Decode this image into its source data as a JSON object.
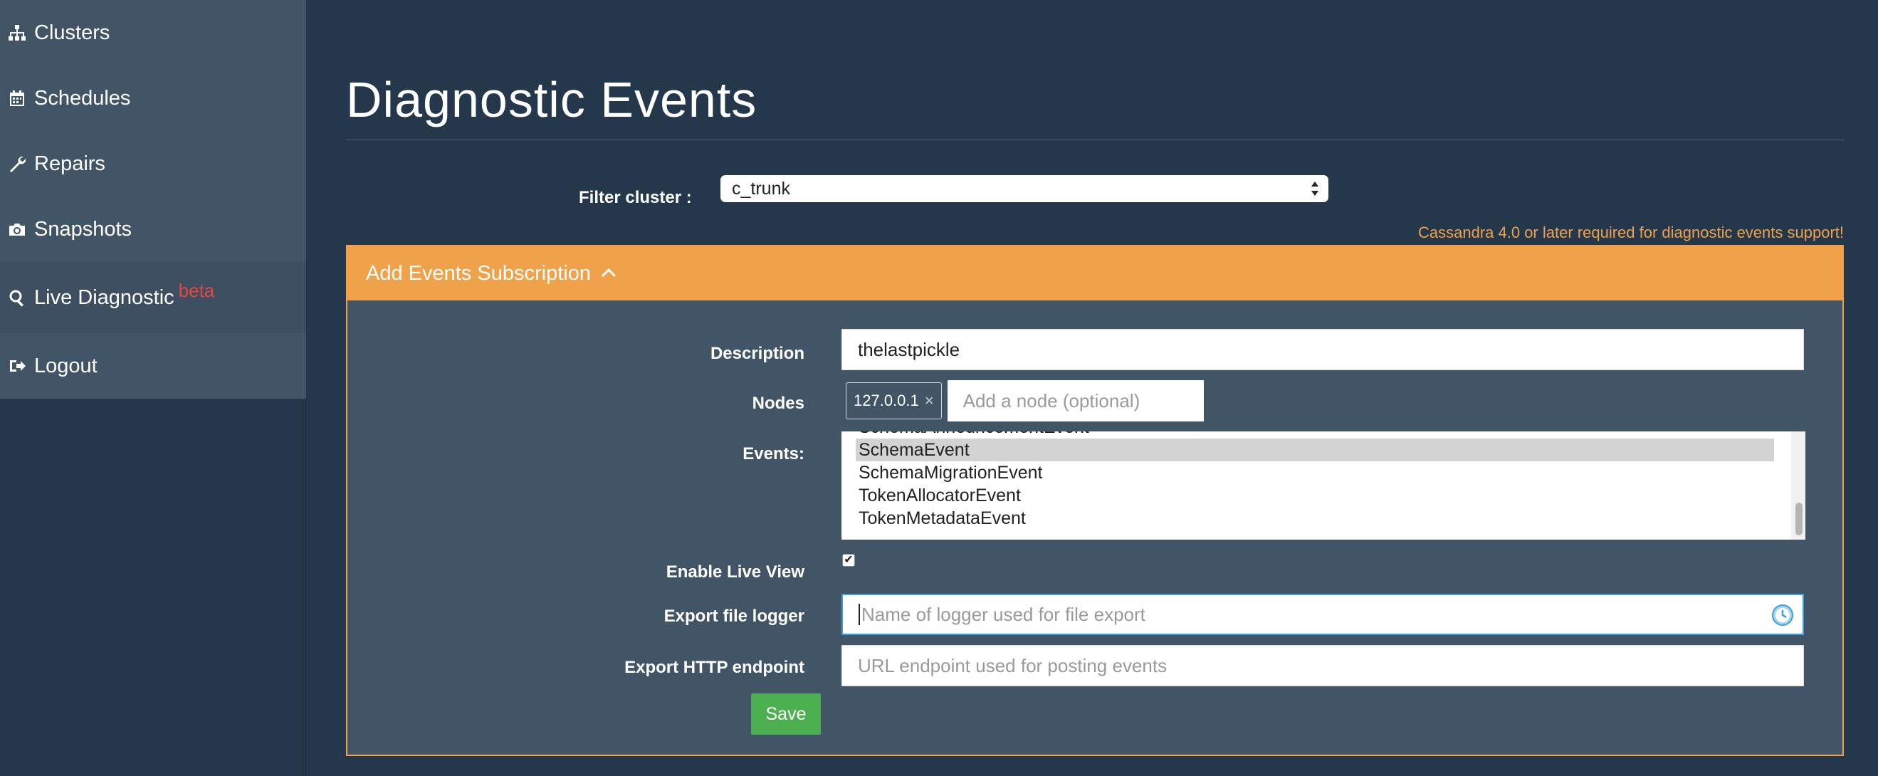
{
  "sidebar": {
    "items": [
      {
        "label": "Clusters",
        "icon": "sitemap-icon"
      },
      {
        "label": "Schedules",
        "icon": "calendar-icon"
      },
      {
        "label": "Repairs",
        "icon": "wrench-icon"
      },
      {
        "label": "Snapshots",
        "icon": "camera-icon"
      },
      {
        "label": "Live Diagnostic",
        "icon": "search-icon",
        "badge": "beta"
      },
      {
        "label": "Logout",
        "icon": "logout-icon"
      }
    ]
  },
  "page": {
    "title": "Diagnostic Events"
  },
  "filter": {
    "label": "Filter cluster :",
    "selected": "c_trunk"
  },
  "warning": "Cassandra 4.0 or later required for diagnostic events support!",
  "panel": {
    "title": "Add Events Subscription",
    "form": {
      "description_label": "Description",
      "description_value": "thelastpickle",
      "nodes_label": "Nodes",
      "node_tag": "127.0.0.1",
      "node_tag_remove": "×",
      "nodes_placeholder": "Add a node (optional)",
      "events_label": "Events:",
      "events": [
        {
          "name": "SchemaAnnouncementEvent",
          "selected": false
        },
        {
          "name": "SchemaEvent",
          "selected": true
        },
        {
          "name": "SchemaMigrationEvent",
          "selected": false
        },
        {
          "name": "TokenAllocatorEvent",
          "selected": false
        },
        {
          "name": "TokenMetadataEvent",
          "selected": false
        }
      ],
      "live_view_label": "Enable Live View",
      "live_view_checked": true,
      "export_file_label": "Export file logger",
      "export_file_placeholder": "Name of logger used for file export",
      "export_http_label": "Export HTTP endpoint",
      "export_http_placeholder": "URL endpoint used for posting events",
      "save_label": "Save"
    }
  },
  "colors": {
    "background": "#25374a",
    "sidebar": "#425566",
    "accent": "#f0a24b",
    "beta": "#e84545",
    "save": "#4caf50",
    "focus": "#3ea0d8"
  }
}
